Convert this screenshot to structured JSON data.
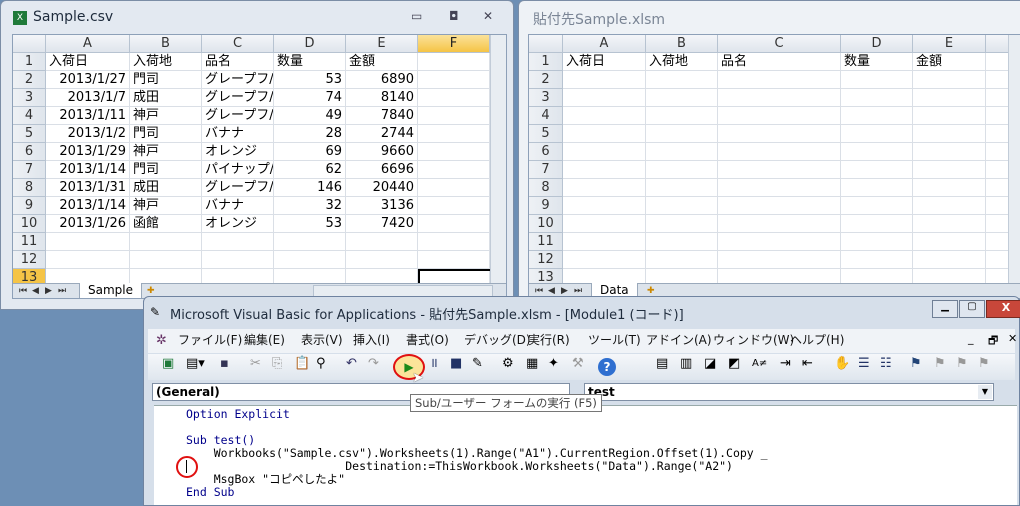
{
  "left_window": {
    "title": "Sample.csv",
    "columns": [
      "A",
      "B",
      "C",
      "D",
      "E",
      "F"
    ],
    "selected_column": "F",
    "rows": [
      [
        "入荷日",
        "入荷地",
        "品名",
        "数量",
        "金額"
      ],
      [
        "2013/1/27",
        "門司",
        "グレープフ/",
        "53",
        "6890"
      ],
      [
        "2013/1/7",
        "成田",
        "グレープフ/",
        "74",
        "8140"
      ],
      [
        "2013/1/11",
        "神戸",
        "グレープフ/",
        "49",
        "7840"
      ],
      [
        "2013/1/2",
        "門司",
        "バナナ",
        "28",
        "2744"
      ],
      [
        "2013/1/29",
        "神戸",
        "オレンジ",
        "69",
        "9660"
      ],
      [
        "2013/1/14",
        "門司",
        "パイナップ/",
        "62",
        "6696"
      ],
      [
        "2013/1/31",
        "成田",
        "グレープフ/",
        "146",
        "20440"
      ],
      [
        "2013/1/14",
        "神戸",
        "バナナ",
        "32",
        "3136"
      ],
      [
        "2013/1/26",
        "函館",
        "オレンジ",
        "53",
        "7420"
      ],
      [
        "",
        "",
        "",
        "",
        ""
      ],
      [
        "",
        "",
        "",
        "",
        ""
      ],
      [
        "",
        "",
        "",
        "",
        ""
      ]
    ],
    "row_numbers": [
      "1",
      "2",
      "3",
      "4",
      "5",
      "6",
      "7",
      "8",
      "9",
      "10",
      "11",
      "12",
      "13"
    ],
    "sheet_tab": "Sample"
  },
  "right_window": {
    "title": "貼付先Sample.xlsm",
    "columns": [
      "A",
      "B",
      "C",
      "D",
      "E"
    ],
    "header_row": [
      "入荷日",
      "入荷地",
      "品名",
      "数量",
      "金額"
    ],
    "row_numbers": [
      "1",
      "2",
      "3",
      "4",
      "5",
      "6",
      "7",
      "8",
      "9",
      "10",
      "11",
      "12",
      "13"
    ],
    "sheet_tab": "Data"
  },
  "vba": {
    "title": "Microsoft Visual Basic for Applications - 貼付先Sample.xlsm - [Module1 (コード)]",
    "menu": [
      "ファイル(F)",
      "編集(E)",
      "表示(V)",
      "挿入(I)",
      "書式(O)",
      "デバッグ(D)",
      "実行(R)",
      "ツール(T)",
      "アドイン(A)",
      "ウィンドウ(W)",
      "ヘルプ(H)"
    ],
    "object_combo": "(General)",
    "proc_combo": "test",
    "tooltip": "Sub/ユーザー フォームの実行 (F5)",
    "code": [
      "Option Explicit",
      "",
      "Sub test()",
      "    Workbooks(\"Sample.csv\").Worksheets(1).Range(\"A1\").CurrentRegion.Offset(1).Copy _",
      "                       Destination:=ThisWorkbook.Worksheets(\"Data\").Range(\"A2\")",
      "    MsgBox \"コピペしたよ\"",
      "End Sub"
    ]
  }
}
